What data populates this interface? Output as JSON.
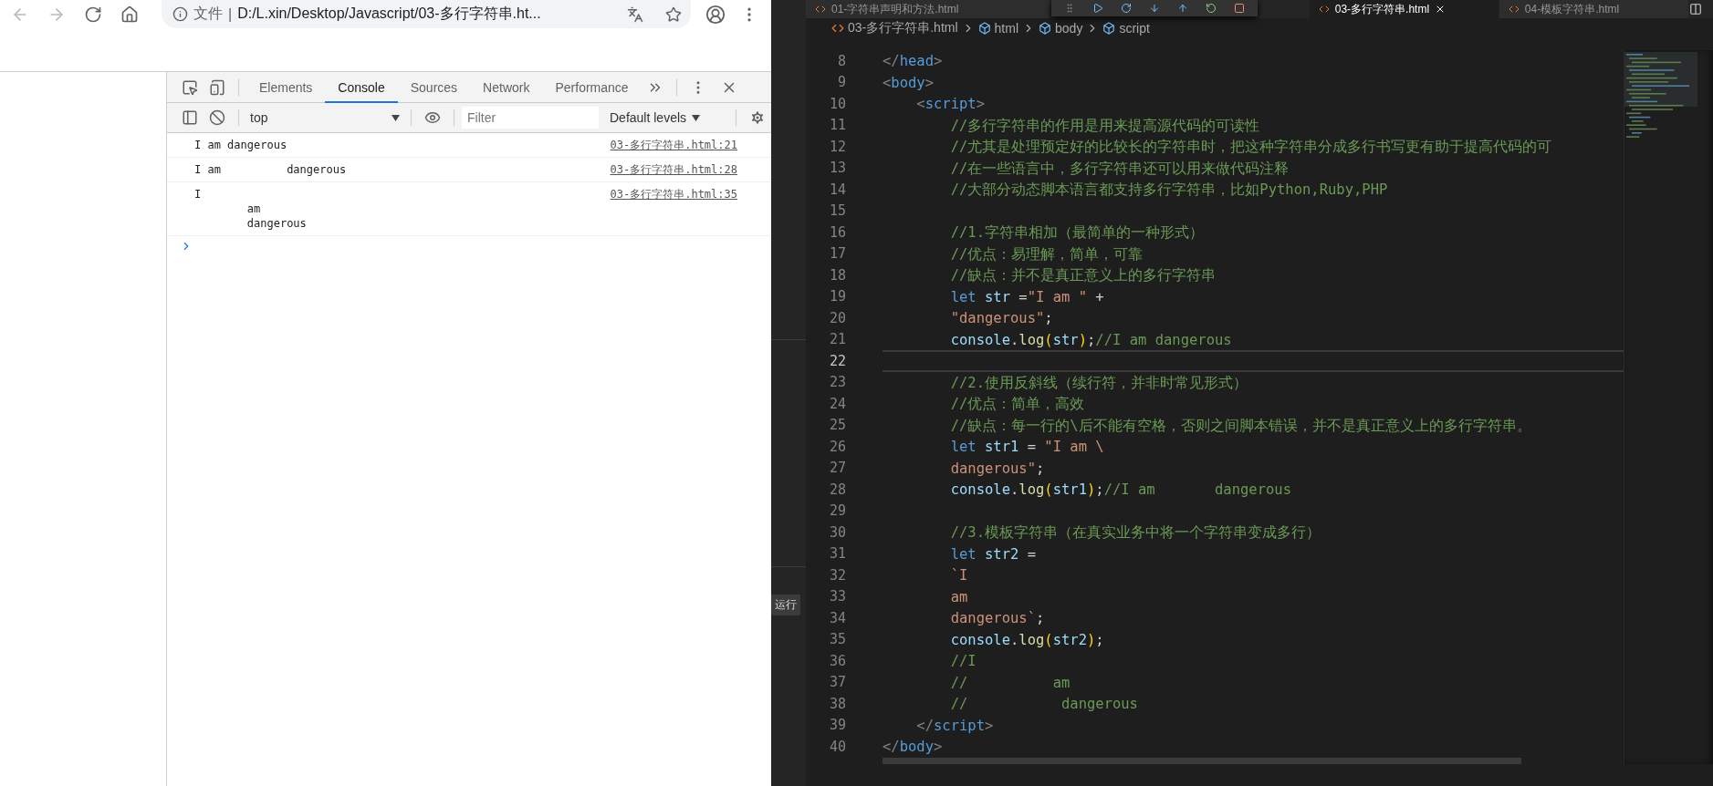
{
  "browser": {
    "nav": [
      {
        "kind": "back",
        "disabled": true
      },
      {
        "kind": "forward",
        "disabled": true
      },
      {
        "kind": "reload",
        "disabled": false
      },
      {
        "kind": "home",
        "disabled": false
      }
    ],
    "address": {
      "scheme": "文件",
      "separator": "|",
      "url": "D:/L.xin/Desktop/Javascript/03-多行字符串.ht..."
    },
    "devtools": {
      "tabs": [
        {
          "label": "Elements",
          "selected": false
        },
        {
          "label": "Console",
          "selected": true
        },
        {
          "label": "Sources",
          "selected": false
        },
        {
          "label": "Network",
          "selected": false
        },
        {
          "label": "Performance",
          "selected": false
        }
      ],
      "context": "top",
      "filter": {
        "placeholder": "Filter"
      },
      "levels": "Default levels",
      "messages": [
        {
          "text": "I am dangerous",
          "source": "03-多行字符串.html:21"
        },
        {
          "text": "I am          dangerous",
          "source": "03-多行字符串.html:28"
        },
        {
          "text": "I\n        am\n        dangerous",
          "source": "03-多行字符串.html:35"
        }
      ]
    }
  },
  "side_panel": {
    "tag": "运行"
  },
  "editor": {
    "tabs": [
      {
        "label": "01-字符串声明和方法.html",
        "selected": false
      },
      {
        "label": "03-多行字符串.html",
        "selected": true
      },
      {
        "label": "04-模板字符串.html",
        "selected": false
      }
    ],
    "breadcrumb": [
      {
        "kind": "file",
        "label": "03-多行字符串.html"
      },
      {
        "kind": "symbol",
        "label": "html"
      },
      {
        "kind": "symbol",
        "label": "body"
      },
      {
        "kind": "symbol",
        "label": "script"
      }
    ],
    "lines": [
      {
        "number": "8",
        "current": false,
        "tokens": [
          {
            "kind": "bracket",
            "text": "</"
          },
          {
            "kind": "tag",
            "text": "head"
          },
          {
            "kind": "bracket",
            "text": ">"
          }
        ]
      },
      {
        "number": "9",
        "current": false,
        "tokens": [
          {
            "kind": "bracket",
            "text": "<"
          },
          {
            "kind": "tag",
            "text": "body"
          },
          {
            "kind": "bracket",
            "text": ">"
          }
        ]
      },
      {
        "number": "10",
        "current": false,
        "tokens": [
          {
            "kind": "bracket",
            "text": "    <"
          },
          {
            "kind": "tag",
            "text": "script"
          },
          {
            "kind": "bracket",
            "text": ">"
          }
        ]
      },
      {
        "number": "11",
        "current": false,
        "tokens": [
          {
            "kind": "comment",
            "text": "        //多行字符串的作用是用来提高源代码的可读性"
          }
        ]
      },
      {
        "number": "12",
        "current": false,
        "tokens": [
          {
            "kind": "comment",
            "text": "        //尤其是处理预定好的比较长的字符串时，把这种字符串分成多行书写更有助于提高代码的可"
          }
        ]
      },
      {
        "number": "13",
        "current": false,
        "tokens": [
          {
            "kind": "comment",
            "text": "        //在一些语言中，多行字符串还可以用来做代码注释"
          }
        ]
      },
      {
        "number": "14",
        "current": false,
        "tokens": [
          {
            "kind": "comment",
            "text": "        //大部分动态脚本语言都支持多行字符串，比如Python,Ruby,PHP"
          }
        ]
      },
      {
        "number": "15",
        "current": false
      },
      {
        "number": "16",
        "current": false,
        "tokens": [
          {
            "kind": "comment",
            "text": "        //1.字符串相加（最简单的一种形式）"
          }
        ]
      },
      {
        "number": "17",
        "current": false,
        "tokens": [
          {
            "kind": "comment",
            "text": "        //优点：易理解，简单，可靠"
          }
        ]
      },
      {
        "number": "18",
        "current": false,
        "tokens": [
          {
            "kind": "comment",
            "text": "        //缺点：并不是真正意义上的多行字符串"
          }
        ]
      },
      {
        "number": "19",
        "current": false,
        "tokens": [
          {
            "kind": "keyword",
            "text": "        let"
          },
          {
            "kind": "variable",
            "text": " str"
          },
          {
            "kind": "plain",
            "text": " ="
          },
          {
            "kind": "string",
            "text": "\"I am \""
          },
          {
            "kind": "plain",
            "text": " +"
          }
        ]
      },
      {
        "number": "20",
        "current": false,
        "tokens": [
          {
            "kind": "string",
            "text": "        \"dangerous\""
          },
          {
            "kind": "plain",
            "text": ";"
          }
        ]
      },
      {
        "number": "21",
        "current": false,
        "tokens": [
          {
            "kind": "variable",
            "text": "        console"
          },
          {
            "kind": "plain",
            "text": "."
          },
          {
            "kind": "function",
            "text": "log"
          },
          {
            "kind": "paren",
            "text": "("
          },
          {
            "kind": "variable",
            "text": "str"
          },
          {
            "kind": "paren",
            "text": ")"
          },
          {
            "kind": "plain",
            "text": ";"
          },
          {
            "kind": "comment",
            "text": "//I am dangerous"
          }
        ]
      },
      {
        "number": "22",
        "current": true
      },
      {
        "number": "23",
        "current": false,
        "tokens": [
          {
            "kind": "comment",
            "text": "        //2.使用反斜线（续行符，并非时常见形式）"
          }
        ]
      },
      {
        "number": "24",
        "current": false,
        "tokens": [
          {
            "kind": "comment",
            "text": "        //优点：简单，高效"
          }
        ]
      },
      {
        "number": "25",
        "current": false,
        "tokens": [
          {
            "kind": "comment",
            "text": "        //缺点：每一行的\\后不能有空格，否则之间脚本错误，并不是真正意义上的多行字符串。"
          }
        ]
      },
      {
        "number": "26",
        "current": false,
        "tokens": [
          {
            "kind": "keyword",
            "text": "        let"
          },
          {
            "kind": "variable",
            "text": " str1"
          },
          {
            "kind": "plain",
            "text": " = "
          },
          {
            "kind": "string",
            "text": "\"I am \\"
          }
        ]
      },
      {
        "number": "27",
        "current": false,
        "tokens": [
          {
            "kind": "string",
            "text": "        dangerous\""
          },
          {
            "kind": "plain",
            "text": ";"
          }
        ]
      },
      {
        "number": "28",
        "current": false,
        "tokens": [
          {
            "kind": "variable",
            "text": "        console"
          },
          {
            "kind": "plain",
            "text": "."
          },
          {
            "kind": "function",
            "text": "log"
          },
          {
            "kind": "paren",
            "text": "("
          },
          {
            "kind": "variable",
            "text": "str1"
          },
          {
            "kind": "paren",
            "text": ")"
          },
          {
            "kind": "plain",
            "text": ";"
          },
          {
            "kind": "comment",
            "text": "//I am       dangerous"
          }
        ]
      },
      {
        "number": "29",
        "current": false
      },
      {
        "number": "30",
        "current": false,
        "tokens": [
          {
            "kind": "comment",
            "text": "        //3.模板字符串（在真实业务中将一个字符串变成多行）"
          }
        ]
      },
      {
        "number": "31",
        "current": false,
        "tokens": [
          {
            "kind": "keyword",
            "text": "        let"
          },
          {
            "kind": "variable",
            "text": " str2"
          },
          {
            "kind": "plain",
            "text": " ="
          }
        ]
      },
      {
        "number": "32",
        "current": false,
        "tokens": [
          {
            "kind": "string",
            "text": "        `I"
          }
        ]
      },
      {
        "number": "33",
        "current": false,
        "tokens": [
          {
            "kind": "string",
            "text": "        am"
          }
        ]
      },
      {
        "number": "34",
        "current": false,
        "tokens": [
          {
            "kind": "string",
            "text": "        dangerous`"
          },
          {
            "kind": "plain",
            "text": ";"
          }
        ]
      },
      {
        "number": "35",
        "current": false,
        "tokens": [
          {
            "kind": "variable",
            "text": "        console"
          },
          {
            "kind": "plain",
            "text": "."
          },
          {
            "kind": "function",
            "text": "log"
          },
          {
            "kind": "paren",
            "text": "("
          },
          {
            "kind": "variable",
            "text": "str2"
          },
          {
            "kind": "paren",
            "text": ")"
          },
          {
            "kind": "plain",
            "text": ";"
          }
        ]
      },
      {
        "number": "36",
        "current": false,
        "tokens": [
          {
            "kind": "comment",
            "text": "        //I"
          }
        ]
      },
      {
        "number": "37",
        "current": false,
        "tokens": [
          {
            "kind": "comment",
            "text": "        //          am"
          }
        ]
      },
      {
        "number": "38",
        "current": false,
        "tokens": [
          {
            "kind": "comment",
            "text": "        //           dangerous"
          }
        ]
      },
      {
        "number": "39",
        "current": false,
        "tokens": [
          {
            "kind": "bracket",
            "text": "    </"
          },
          {
            "kind": "tag",
            "text": "script"
          },
          {
            "kind": "bracket",
            "text": ">"
          }
        ]
      },
      {
        "number": "40",
        "current": false,
        "tokens": [
          {
            "kind": "bracket",
            "text": "</"
          },
          {
            "kind": "tag",
            "text": "body"
          },
          {
            "kind": "bracket",
            "text": ">"
          }
        ]
      }
    ]
  }
}
